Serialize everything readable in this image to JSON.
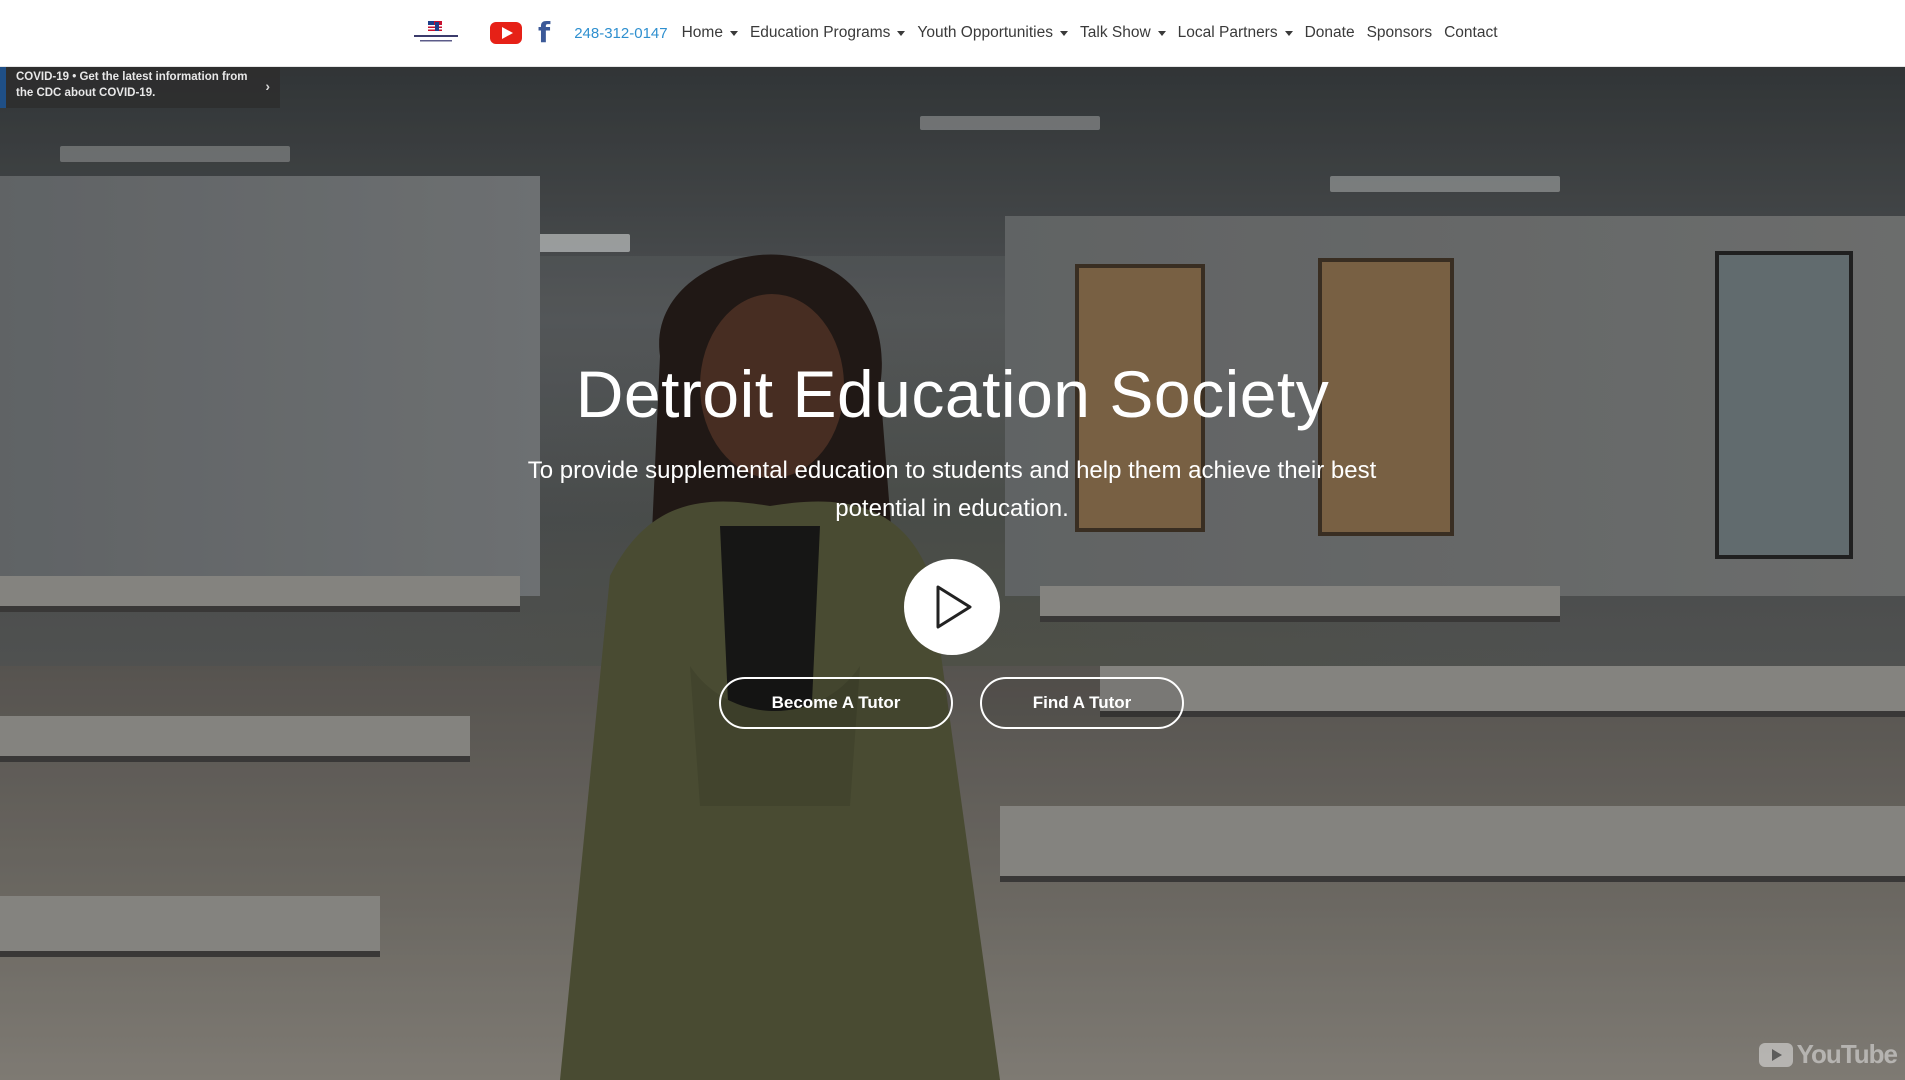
{
  "nav": {
    "phone": "248-312-0147",
    "items": [
      {
        "label": "Home",
        "dropdown": true
      },
      {
        "label": "Education Programs",
        "dropdown": true
      },
      {
        "label": "Youth Opportunities",
        "dropdown": true
      },
      {
        "label": "Talk Show",
        "dropdown": true
      },
      {
        "label": "Local Partners",
        "dropdown": true
      },
      {
        "label": "Donate",
        "dropdown": false
      },
      {
        "label": "Sponsors",
        "dropdown": false
      },
      {
        "label": "Contact",
        "dropdown": false
      }
    ],
    "icons": [
      "site-logo",
      "youtube-icon",
      "facebook-icon"
    ]
  },
  "covid_banner": {
    "text": "COVID-19 • Get the latest information from the CDC about COVID-19."
  },
  "hero": {
    "title": "Detroit Education Society",
    "subtitle": "To provide supplemental education to students and help them achieve their best potential in education.",
    "buttons": {
      "become_tutor": "Become A Tutor",
      "find_tutor": "Find A Tutor"
    },
    "watermark": "YouTube"
  },
  "colors": {
    "phone": "#2e8fcf",
    "youtube_red": "#e62117",
    "facebook_blue": "#3b5998",
    "banner_accent": "#1f4f86"
  }
}
